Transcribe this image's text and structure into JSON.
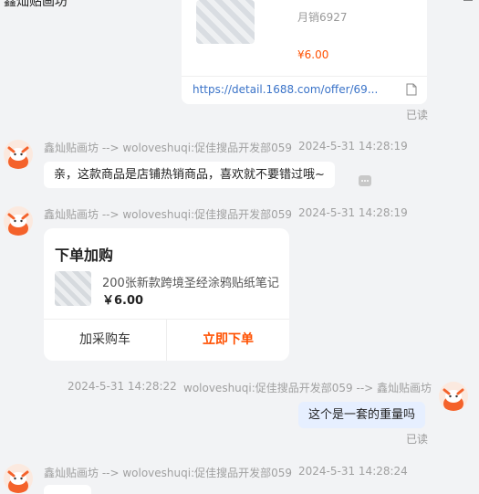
{
  "window": {
    "title": "鑫灿贴画坊"
  },
  "msg1": {
    "sales": "月销6927",
    "price": "¥6.00",
    "url": "https://detail.1688.com/offer/69...",
    "read": "已读"
  },
  "msg2": {
    "sender": "鑫灿贴画坊 --> woloveshuqi:促佳搜品开发部059",
    "time": "2024-5-31 14:28:19",
    "text": "亲，这款商品是店铺热销商品，喜欢就不要错过哦~"
  },
  "msg3": {
    "sender": "鑫灿贴画坊 --> woloveshuqi:促佳搜品开发部059",
    "time": "2024-5-31 14:28:19",
    "card_title": "下单加购",
    "product_name": "200张新款跨境圣经涂鸦贴纸笔记",
    "product_price": "￥6.00",
    "btn_cart": "加采购车",
    "btn_buy": "立即下单"
  },
  "msg4": {
    "time": "2024-5-31 14:28:22",
    "sender": "woloveshuqi:促佳搜品开发部059 --> 鑫灿贴画坊",
    "text": "这个是一套的重量吗",
    "read": "已读"
  },
  "msg5": {
    "sender": "鑫灿贴画坊 --> woloveshuqi:促佳搜品开发部059",
    "time": "2024-5-31 14:28:24"
  }
}
